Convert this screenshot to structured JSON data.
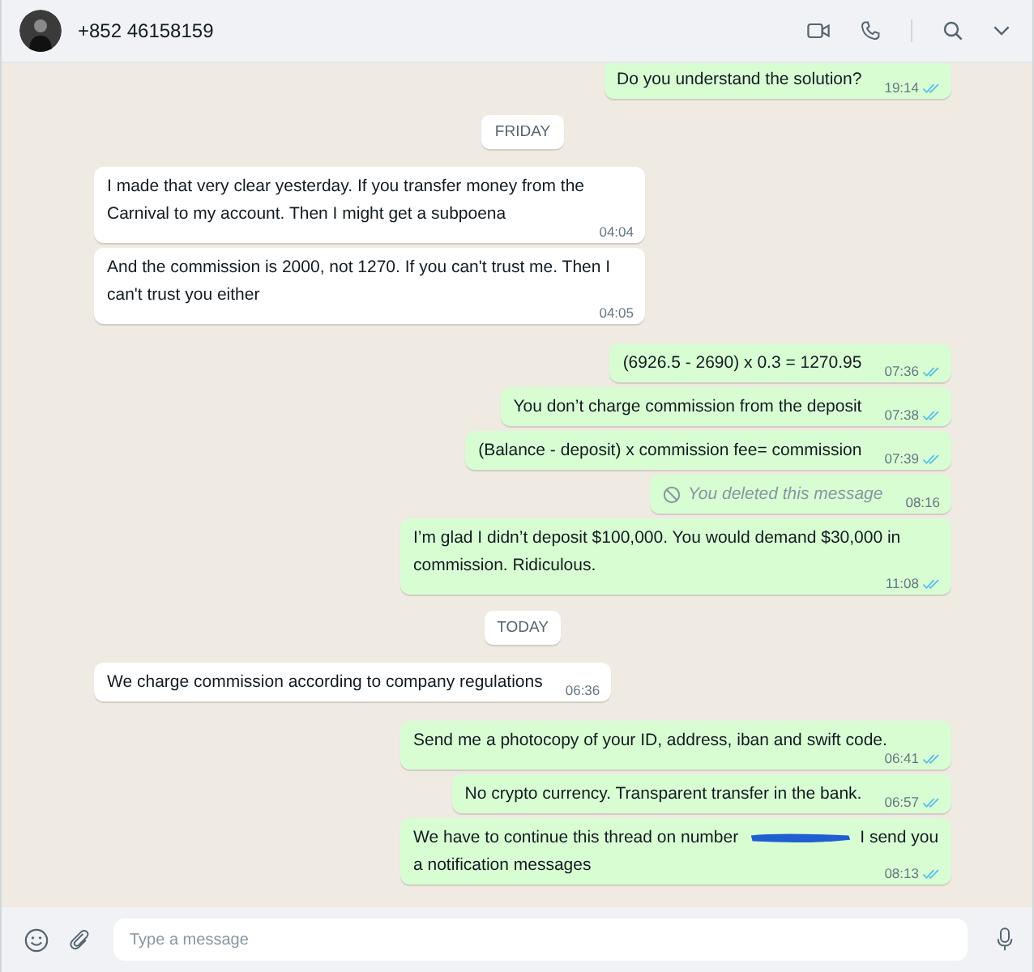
{
  "header": {
    "title": "+852 46158159"
  },
  "messages": [
    {
      "kind": "message",
      "outgoing": true,
      "text": "Do you understand the solution?",
      "time": "19:14",
      "read": true
    },
    {
      "kind": "date",
      "text": "FRIDAY"
    },
    {
      "kind": "message",
      "outgoing": false,
      "text": "I made that very clear yesterday. If you transfer money from the Carnival to my account. Then I might get a subpoena",
      "time": "04:04"
    },
    {
      "kind": "message",
      "outgoing": false,
      "text": "And the commission is 2000, not 1270. If you can't trust me. Then I can't trust you either",
      "time": "04:05"
    },
    {
      "kind": "message",
      "outgoing": true,
      "text": "(6926.5 - 2690) x 0.3 = 1270.95",
      "time": "07:36",
      "read": true
    },
    {
      "kind": "message",
      "outgoing": true,
      "text": "You don’t charge commission from the deposit",
      "time": "07:38",
      "read": true
    },
    {
      "kind": "message",
      "outgoing": true,
      "text": "(Balance - deposit) x commission fee= commission",
      "time": "07:39",
      "read": true
    },
    {
      "kind": "deleted",
      "outgoing": true,
      "text": "You deleted this message",
      "time": "08:16"
    },
    {
      "kind": "message",
      "outgoing": true,
      "text": "I’m glad I didn’t deposit $100,000. You would demand $30,000 in commission. Ridiculous.",
      "time": "11:08",
      "read": true
    },
    {
      "kind": "date",
      "text": "TODAY"
    },
    {
      "kind": "message",
      "outgoing": false,
      "text": "We charge commission according to company regulations",
      "time": "06:36"
    },
    {
      "kind": "message",
      "outgoing": true,
      "text": "Send me a photocopy of your ID, address, iban and swift code.",
      "time": "06:41",
      "read": true
    },
    {
      "kind": "message",
      "outgoing": true,
      "text": "No crypto currency. Transparent transfer in the bank.",
      "time": "06:57",
      "read": true
    },
    {
      "kind": "redacted",
      "outgoing": true,
      "text": "We have to continue this thread on number",
      "text_after": "I send you",
      "text_continued": "a notification messages",
      "time": "08:13",
      "read": true
    }
  ],
  "composer": {
    "placeholder": "Type a message"
  }
}
